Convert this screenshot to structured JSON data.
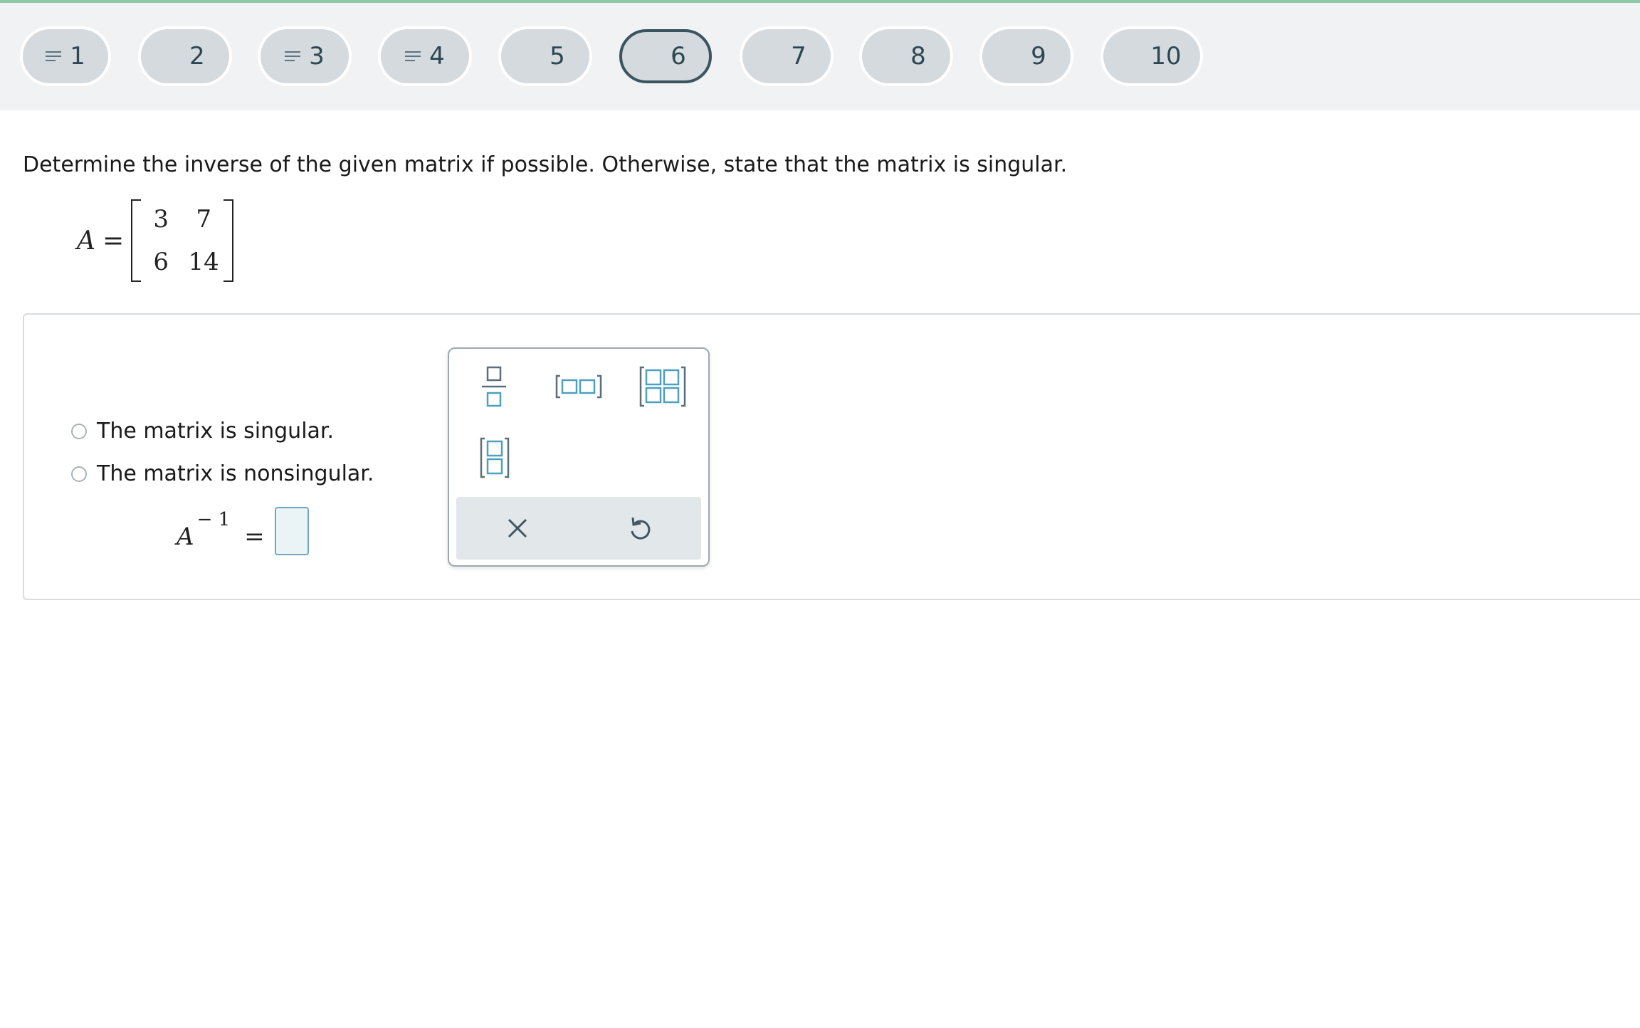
{
  "nav": {
    "questions": [
      {
        "label": "1",
        "has_notes": true,
        "current": false
      },
      {
        "label": "2",
        "has_notes": false,
        "current": false
      },
      {
        "label": "3",
        "has_notes": true,
        "current": false
      },
      {
        "label": "4",
        "has_notes": true,
        "current": false
      },
      {
        "label": "5",
        "has_notes": false,
        "current": false
      },
      {
        "label": "6",
        "has_notes": false,
        "current": true
      },
      {
        "label": "7",
        "has_notes": false,
        "current": false
      },
      {
        "label": "8",
        "has_notes": false,
        "current": false
      },
      {
        "label": "9",
        "has_notes": false,
        "current": false
      },
      {
        "label": "10",
        "has_notes": false,
        "current": false
      }
    ],
    "accent_color": "#8fc9a8"
  },
  "question": {
    "prompt": "Determine the inverse of the given matrix if possible. Otherwise, state that the matrix is singular.",
    "matrix_name": "A",
    "equals": "=",
    "matrix": [
      [
        "3",
        "7"
      ],
      [
        "6",
        "14"
      ]
    ]
  },
  "answer": {
    "options": [
      "The matrix is singular.",
      "The matrix is nonsingular."
    ],
    "inverse_var": "A",
    "inverse_sup": "− 1",
    "equals": "=",
    "input_value": ""
  },
  "palette": {
    "tools": [
      "fraction-icon",
      "row-vector-icon",
      "matrix-2x2-icon",
      "column-vector-icon"
    ],
    "actions": [
      "clear-icon",
      "undo-icon"
    ]
  }
}
